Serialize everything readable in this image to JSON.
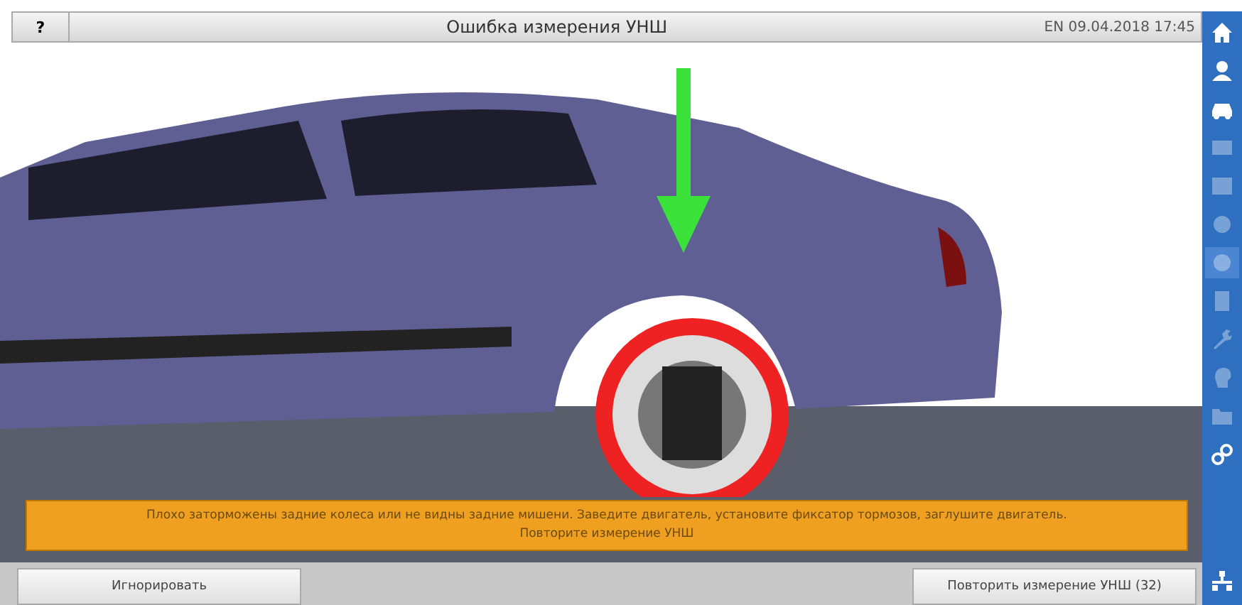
{
  "title_bar": {
    "help": "?",
    "title": "Ошибка измерения УНШ",
    "status": "EN 09.04.2018 17:45"
  },
  "message": "Плохо заторможены задние колеса или не видны задние мишени. Заведите двигатель, установите фиксатор тормозов, заглушите двигатель.\nПовторите измерение УНШ",
  "buttons": [
    {
      "label": "Игнорировать"
    },
    {
      "label": "Повторить измерение УНШ (32)"
    }
  ],
  "sidebar": {
    "items": [
      {
        "kind": "home",
        "disabled": false,
        "selected": false
      },
      {
        "kind": "user",
        "disabled": false,
        "selected": false
      },
      {
        "kind": "car",
        "disabled": false,
        "selected": false
      },
      {
        "kind": "card",
        "disabled": true,
        "selected": false
      },
      {
        "kind": "picture",
        "disabled": true,
        "selected": false
      },
      {
        "kind": "disc",
        "disabled": true,
        "selected": false
      },
      {
        "kind": "disc",
        "disabled": true,
        "selected": true
      },
      {
        "kind": "document",
        "disabled": true,
        "selected": false
      },
      {
        "kind": "wrench",
        "disabled": true,
        "selected": false
      },
      {
        "kind": "head",
        "disabled": true,
        "selected": false
      },
      {
        "kind": "folder",
        "disabled": true,
        "selected": false
      },
      {
        "kind": "gears",
        "disabled": false,
        "selected": false
      }
    ],
    "bottom": {
      "kind": "network"
    }
  }
}
